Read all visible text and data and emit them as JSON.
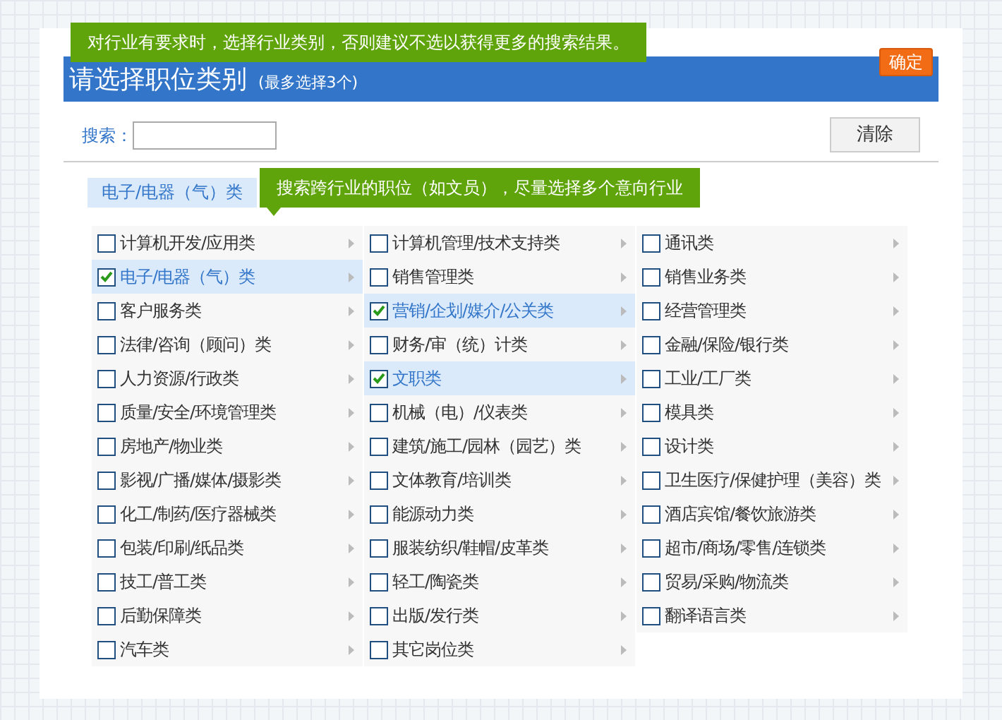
{
  "tip": "对行业有要求时，选择行业类别，否则建议不选以获得更多的搜索结果。",
  "header": {
    "title": "请选择职位类别",
    "note": "(最多选择3个)",
    "confirm": "确定"
  },
  "search": {
    "label": "搜索：",
    "clear": "清除"
  },
  "selected_tags": [
    "电子/电器（气）类"
  ],
  "hint": "搜索跨行业的职位（如文员），尽量选择多个意向行业",
  "columns": [
    [
      {
        "label": "计算机开发/应用类",
        "checked": false
      },
      {
        "label": "电子/电器（气）类",
        "checked": true
      },
      {
        "label": "客户服务类",
        "checked": false
      },
      {
        "label": "法律/咨询（顾问）类",
        "checked": false
      },
      {
        "label": "人力资源/行政类",
        "checked": false
      },
      {
        "label": "质量/安全/环境管理类",
        "checked": false
      },
      {
        "label": "房地产/物业类",
        "checked": false
      },
      {
        "label": "影视/广播/媒体/摄影类",
        "checked": false
      },
      {
        "label": "化工/制药/医疗器械类",
        "checked": false
      },
      {
        "label": "包装/印刷/纸品类",
        "checked": false
      },
      {
        "label": "技工/普工类",
        "checked": false
      },
      {
        "label": "后勤保障类",
        "checked": false
      },
      {
        "label": "汽车类",
        "checked": false
      }
    ],
    [
      {
        "label": "计算机管理/技术支持类",
        "checked": false
      },
      {
        "label": "销售管理类",
        "checked": false
      },
      {
        "label": "营销/企划/媒介/公关类",
        "checked": true
      },
      {
        "label": "财务/审（统）计类",
        "checked": false
      },
      {
        "label": "文职类",
        "checked": true
      },
      {
        "label": "机械（电）/仪表类",
        "checked": false
      },
      {
        "label": "建筑/施工/园林（园艺）类",
        "checked": false
      },
      {
        "label": "文体教育/培训类",
        "checked": false
      },
      {
        "label": "能源动力类",
        "checked": false
      },
      {
        "label": "服装纺织/鞋帽/皮革类",
        "checked": false
      },
      {
        "label": "轻工/陶瓷类",
        "checked": false
      },
      {
        "label": "出版/发行类",
        "checked": false
      },
      {
        "label": "其它岗位类",
        "checked": false
      }
    ],
    [
      {
        "label": "通讯类",
        "checked": false
      },
      {
        "label": "销售业务类",
        "checked": false
      },
      {
        "label": "经营管理类",
        "checked": false
      },
      {
        "label": "金融/保险/银行类",
        "checked": false
      },
      {
        "label": "工业/工厂类",
        "checked": false
      },
      {
        "label": "模具类",
        "checked": false
      },
      {
        "label": "设计类",
        "checked": false
      },
      {
        "label": "卫生医疗/保健护理（美容）类",
        "checked": false
      },
      {
        "label": "酒店宾馆/餐饮旅游类",
        "checked": false
      },
      {
        "label": "超市/商场/零售/连锁类",
        "checked": false
      },
      {
        "label": "贸易/采购/物流类",
        "checked": false
      },
      {
        "label": "翻译语言类",
        "checked": false
      }
    ]
  ]
}
